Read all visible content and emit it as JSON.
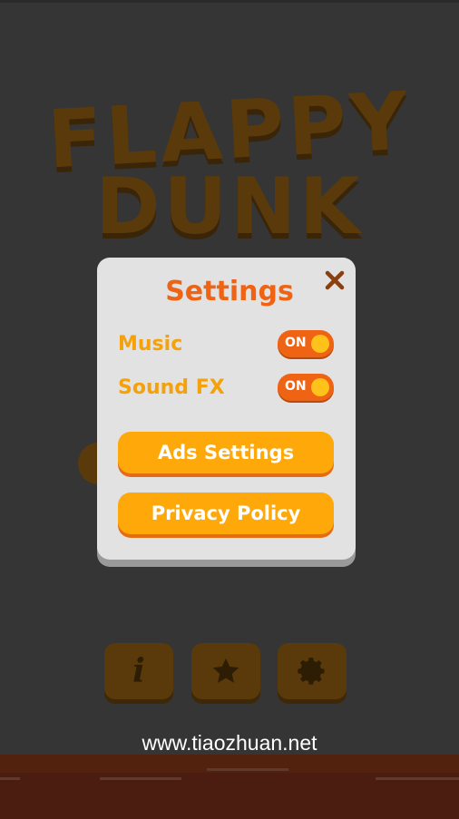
{
  "background": {
    "logo_line1": "FLAPPY",
    "logo_line2": "DUNK",
    "menu_icons": [
      "info-icon",
      "star-icon",
      "gear-icon"
    ]
  },
  "settings": {
    "title": "Settings",
    "close_icon": "close-icon",
    "music_label": "Music",
    "music_state": "ON",
    "sfx_label": "Sound FX",
    "sfx_state": "ON",
    "ads_button": "Ads Settings",
    "privacy_button": "Privacy Policy"
  },
  "watermark": "www.tiaozhuan.net",
  "colors": {
    "accent_orange": "#ef6414",
    "button_orange": "#ffa80a",
    "label_orange": "#f5a10b",
    "modal_bg": "#e2e2e2",
    "knob_yellow": "#ffc21a"
  }
}
